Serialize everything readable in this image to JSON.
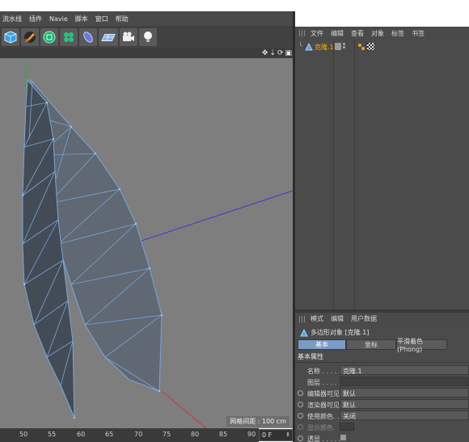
{
  "menu": [
    "流水线",
    "插件",
    "Navie",
    "脚本",
    "窗口",
    "帮助"
  ],
  "toolbar": {
    "tools": [
      "cube-icon",
      "pen-icon",
      "subdivision-icon",
      "cloner-icon",
      "deformer-icon",
      "floor-icon",
      "camera-icon",
      "light-icon"
    ]
  },
  "viewport": {
    "grid_readout": "网格间距 : 100 cm",
    "header_icons": [
      "✥",
      "⇣",
      "⟳",
      "▣"
    ]
  },
  "timeline": {
    "ticks": [
      "50",
      "55",
      "60",
      "65",
      "70",
      "75",
      "80",
      "85",
      "90"
    ],
    "frame": "0 F"
  },
  "object_manager": {
    "menu": [
      "文件",
      "编辑",
      "查看",
      "对象",
      "标签",
      "书签"
    ],
    "objects": [
      {
        "name": "克隆.1",
        "icon": "polygon-object-icon",
        "color": "#ffb000"
      }
    ]
  },
  "attribute_manager": {
    "menu": [
      "模式",
      "编辑",
      "用户数据"
    ],
    "title": "多边形对象 [克隆.1]",
    "tabs": [
      "基本",
      "坐标",
      "平滑着色(Phong)"
    ],
    "section": "基本属性",
    "props": {
      "name_label": "名称 . . . . .",
      "name_value": "克隆.1",
      "layer_label": "图层 . . . . .",
      "editor_vis_label": "编辑器可见",
      "editor_vis_value": "默认",
      "render_vis_label": "渲染器可见",
      "render_vis_value": "默认",
      "use_color_label": "使用颜色. . .",
      "use_color_value": "关闭",
      "display_color_label": "显示颜色.",
      "xray_label": "透显 . . . . ."
    }
  },
  "colors": {
    "accent": "#7a9bc6",
    "object_selected": "#ffb000",
    "wire": "#7aa6d8",
    "x_axis": "#c23b3b",
    "z_axis": "#3b3bd0"
  }
}
